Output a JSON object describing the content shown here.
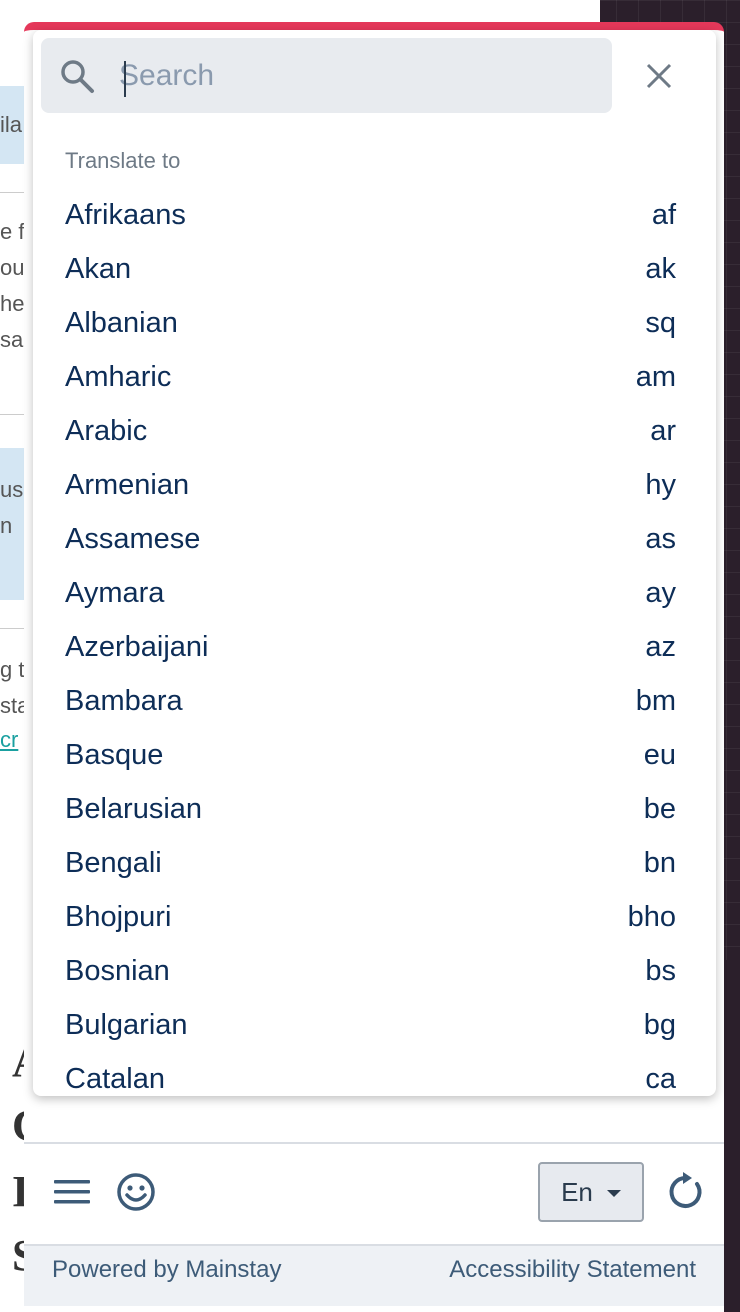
{
  "search": {
    "placeholder": "Search"
  },
  "dropdown": {
    "section_label": "Translate to",
    "languages": [
      {
        "name": "Afrikaans",
        "code": "af"
      },
      {
        "name": "Akan",
        "code": "ak"
      },
      {
        "name": "Albanian",
        "code": "sq"
      },
      {
        "name": "Amharic",
        "code": "am"
      },
      {
        "name": "Arabic",
        "code": "ar"
      },
      {
        "name": "Armenian",
        "code": "hy"
      },
      {
        "name": "Assamese",
        "code": "as"
      },
      {
        "name": "Aymara",
        "code": "ay"
      },
      {
        "name": "Azerbaijani",
        "code": "az"
      },
      {
        "name": "Bambara",
        "code": "bm"
      },
      {
        "name": "Basque",
        "code": "eu"
      },
      {
        "name": "Belarusian",
        "code": "be"
      },
      {
        "name": "Bengali",
        "code": "bn"
      },
      {
        "name": "Bhojpuri",
        "code": "bho"
      },
      {
        "name": "Bosnian",
        "code": "bs"
      },
      {
        "name": "Bulgarian",
        "code": "bg"
      },
      {
        "name": "Catalan",
        "code": "ca"
      }
    ]
  },
  "toolbar": {
    "language_button": "En"
  },
  "footer": {
    "powered_by": "Powered by Mainstay",
    "accessibility": "Accessibility Statement"
  },
  "underlay": {
    "fragments": [
      "ila",
      "e fo",
      "ou",
      "he",
      "sa",
      "us",
      "n",
      "g to",
      "sta",
      "cr"
    ],
    "big_letters": [
      "A",
      "C",
      "I",
      "S"
    ]
  },
  "colors": {
    "accent": "#e5385a",
    "text_primary": "#0d2d57",
    "text_muted": "#6e7a86",
    "footer_text": "#3d5b78"
  },
  "icons": [
    "search-icon",
    "close-icon",
    "menu-icon",
    "emoji-icon",
    "chevron-down-icon",
    "refresh-icon"
  ]
}
